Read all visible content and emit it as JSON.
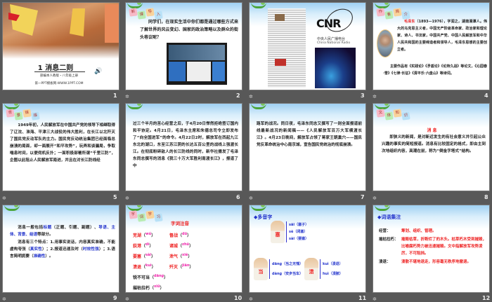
{
  "slides": [
    {
      "number": "1",
      "title": "1 消息二则",
      "subtitle": "部编本人教版・八年级上册",
      "site": "第一PPT模板网-WWW.1PPT.COM"
    },
    {
      "number": "2",
      "tag": [
        "新",
        "课",
        "导",
        "入"
      ],
      "text": "同学们，在现实生活中你们都是通过哪些方式来了解世界的风云变幻、国家的政治策略以及群众的街头巷议呢？"
    },
    {
      "number": "3",
      "logo": "CNR",
      "logo_cn": "中央人民广播电台",
      "logo_en": "China National Radio"
    },
    {
      "number": "4",
      "tag": [
        "作",
        "者",
        "简",
        "介"
      ],
      "name": "毛泽东",
      "bio": "（1893—1976），字润之，湖南湘潭人。伟大的马克思主义者，中国无产阶级革命家、政治家和理论家、诗人、书法家，中国共产党、中国人民解放军和中华人民共和国的主要缔造者和领导人，毛泽东思想的主要创立者。",
      "works": "主要作品有《实践论》《矛盾论》《论持久战》等论文，《沁园春·雪》《七律·长征》《清平乐·六盘山》等诗词。"
    },
    {
      "number": "5",
      "tag": [
        "背",
        "景",
        "链",
        "接"
      ],
      "text": "1949年初，人民解放军在中国共产党的领导下相继取得了辽沈、淮海、平津三大战役的伟大胜利，在长江以北歼灭了国民党反动军队的主力。国民党反动统治集团已经面临总崩溃的局面，却一面展开“和平攻势”，玩弄和谈骗局，争取喘息时间，以便伺机反扑；一面积极部署所谓“千里江防”，企图以此阻止人民解放军南进，并且在对长江防线经"
    },
    {
      "number": "6",
      "text": "过三个半月的苦心经营之后，于4月20日悍然拒绝签订国内和平协定。4月21日，毛泽东主席和朱德总司令立即发布了“向全国进军”的命令。4月22日2时，解放军在西起九江东北的湖口，东至江苏江阴的长达五百公里的战线上强渡长江。在彻底粉碎敌人的长江防线的同时，新华社播发了毛泽东同志撰写的消息《我三十万大军胜利南渡长江》，报道了中"
    },
    {
      "number": "7",
      "text": "路军的战况。同日夜，毛泽东同志又撰写了一则全面报道前线最新战况的新闻稿——《人民解放军百万大军横渡长江》。4月23日晚间，解放军占领了蒋家王朝巢穴——国民党反革命统治中心南京城，宣告国民党统治的彻底崩溃。"
    },
    {
      "number": "8",
      "tag": [
        "文",
        "体",
        "知",
        "识"
      ],
      "heading": "消 息",
      "text": "即狭义的新闻，是对新近发生的有社会意义并引起公众兴趣的事实的简短报道。消息有比较固定的格式，即由主到次地组织内容，高潮在前，称为“倒金字塔式”结构。"
    },
    {
      "number": "9",
      "p1a": "消息一般包括",
      "p1b": "标题",
      "p1c": "（正题、引题、副题）、",
      "p1d": "导语、主体、背景、结语",
      "p1e": "等部分。",
      "p2a": "消息有三个特点：1.用事实说话，内容真实准确，不能虚构夸张（",
      "p2b": "真实性",
      "p2c": "）；2.报道迅速及时（",
      "p2d": "时效性强",
      "p2e": "）；3.语言简明扼要（",
      "p2f": "准确性",
      "p2g": "）。"
    },
    {
      "number": "10",
      "tag": [
        "字",
        "词",
        "学",
        "习"
      ],
      "heading": "字词注音",
      "words": [
        {
          "w": "芜湖",
          "py": "wú"
        },
        {
          "w": "督战",
          "py": "dū"
        },
        {
          "w": "荻港",
          "py": "dí"
        },
        {
          "w": "诸城",
          "py": "zhū"
        },
        {
          "w": "要塞",
          "py": "sài"
        },
        {
          "w": "泄气",
          "py": "xiè"
        },
        {
          "w": "溃退",
          "py": "kuì"
        },
        {
          "w": "歼灭",
          "py": "jiān"
        },
        {
          "w": "锐不可当",
          "py": "dāng"
        },
        {
          "w": "摧枯拉朽",
          "py": "xiǔ"
        }
      ]
    },
    {
      "number": "11",
      "heading": "◆多音字",
      "groups": [
        {
          "char": "塞",
          "items": [
            "sāi（塞子）",
            "sè（闭塞）",
            "sài（要塞）"
          ]
        },
        {
          "char": "当",
          "items": [
            "dāng（当之无愧）",
            "dàng（安步当车）"
          ]
        },
        {
          "char": "溃",
          "items": [
            "kuì（溃退）",
            "huì（溃脓）"
          ]
        }
      ]
    },
    {
      "number": "12",
      "heading": "◆词语集注",
      "entries": [
        {
          "term": "经营：",
          "def": "筹划、组织、管理。"
        },
        {
          "term": "摧枯拉朽：",
          "def": "摧毁枯草，折断烂了的木头。枯草朽木受到摧毁，比喻腐朽势力被迅速摧毁。文中指解放军攻势凌厉，不可阻挡。"
        },
        {
          "term": "溃退：",
          "def": "溃散不堪地退走，形容毫无秩序地撤退。"
        }
      ]
    }
  ]
}
